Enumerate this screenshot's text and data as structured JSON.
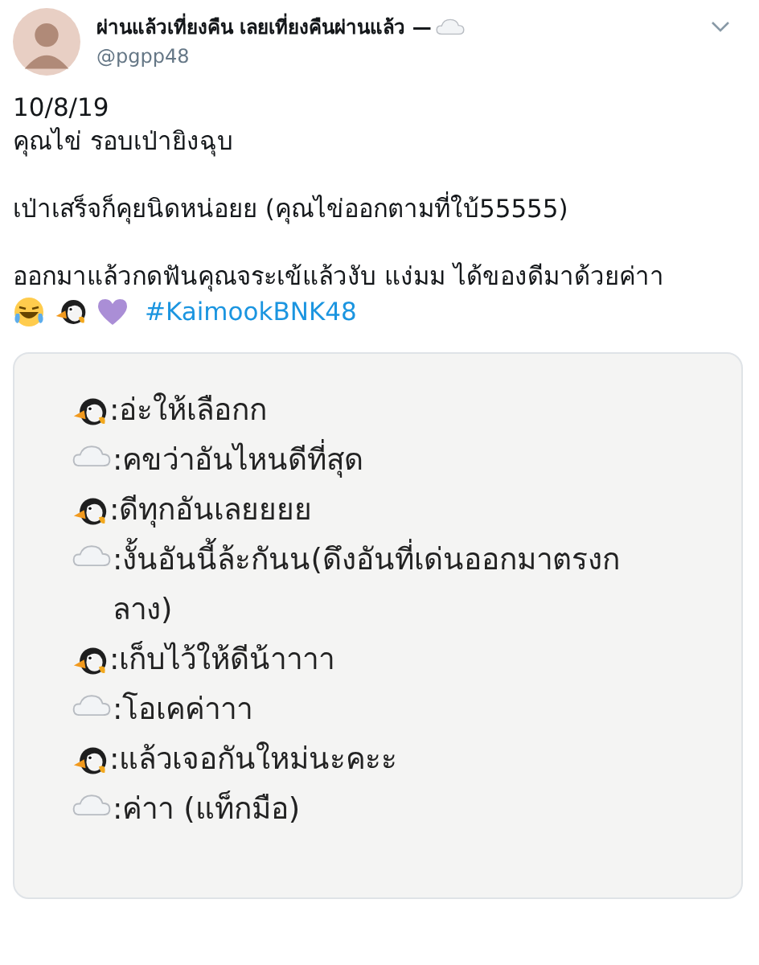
{
  "author": {
    "name": "ผ่านแล้วเที่ยงคืน เลยเที่ยงคืนผ่านแล้ว —",
    "handle": "@pgpp48"
  },
  "body": {
    "paragraphs": [
      "10/8/19\nคุณไข่ รอบเป่ายิงฉุบ",
      "เป่าเสร็จก็คุยนิดหน่อยย (คุณไข่ออกตามที่ใบ้55555)",
      "ออกมาแล้วกดฟันคุณจระเข้แล้วงับ แง่มม ได้ของดีมาด้วยค่าา"
    ],
    "hashtag": "#KaimookBNK48"
  },
  "note": {
    "lines": [
      {
        "kind": "penguin",
        "text": ":อ่ะให้เลือกก"
      },
      {
        "kind": "cloud",
        "text": ":คขว่าอันไหนดีที่สุด"
      },
      {
        "kind": "penguin",
        "text": ":ดีทุกอันเลยยยย"
      },
      {
        "kind": "cloud",
        "text": ":งั้นอันนี้ล้ะกันน(ดึงอันที่เด่นออกมาตรงกลาง)"
      },
      {
        "kind": "penguin",
        "text": ":เก็บไว้ให้ดีน้าาาา"
      },
      {
        "kind": "cloud",
        "text": ":โอเคค่าาา"
      },
      {
        "kind": "penguin",
        "text": ":แล้วเจอกันใหม่นะคะะ"
      },
      {
        "kind": "cloud",
        "text": ":ค่าา (แท็กมือ)"
      }
    ]
  }
}
